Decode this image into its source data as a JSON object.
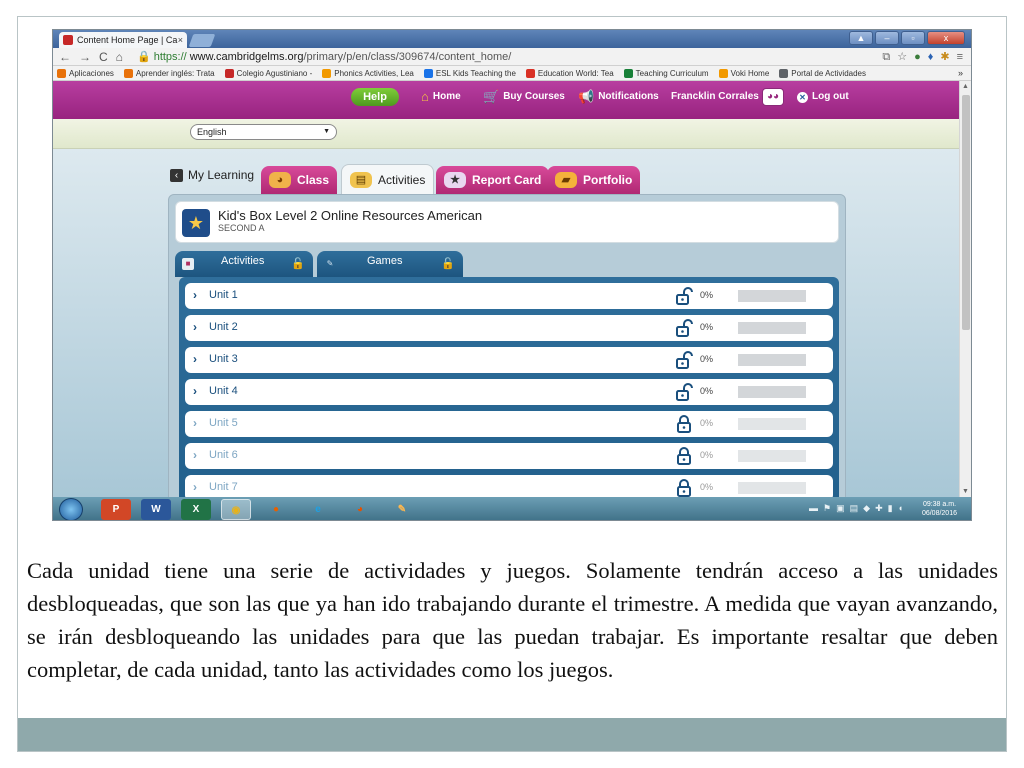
{
  "browser": {
    "tab_title": "Content Home Page | Ca",
    "url_scheme": "https://",
    "url_host": "www.cambridgelms.org",
    "url_path": "/primary/p/en/class/309674/content_home/",
    "bookmarks": [
      {
        "label": "Aplicaciones",
        "color": "#5f6368"
      },
      {
        "label": "Aprender inglés: Trata",
        "color": "#e8710a"
      },
      {
        "label": "Colegio Agustiniano -",
        "color": "#c62828"
      },
      {
        "label": "Phonics Activities, Lea",
        "color": "#f29900"
      },
      {
        "label": "ESL Kids Teaching the",
        "color": "#1a73e8"
      },
      {
        "label": "Education World: Tea",
        "color": "#d93025"
      },
      {
        "label": "Teaching Curriculum",
        "color": "#188038"
      },
      {
        "label": "Voki Home",
        "color": "#f29900"
      },
      {
        "label": "Portal de Actividades",
        "color": "#5f6368"
      }
    ],
    "bookmarks_more": "»"
  },
  "site_nav": {
    "help": "Help",
    "home": "Home",
    "buy_courses": "Buy Courses",
    "notifications": "Notifications",
    "user_name": "Francklin Corrales",
    "logout": "Log out"
  },
  "language": {
    "selected": "English"
  },
  "learning": {
    "my_learning": "My Learning",
    "tabs": [
      {
        "label": "Class"
      },
      {
        "label": "Activities"
      },
      {
        "label": "Report Card"
      },
      {
        "label": "Portfolio"
      }
    ]
  },
  "course": {
    "title": "Kid's Box Level 2 Online Resources American",
    "subtitle": "SECOND A"
  },
  "sub_tabs": [
    {
      "label": "Activities"
    },
    {
      "label": "Games"
    }
  ],
  "units": [
    {
      "label": "Unit 1",
      "progress": "0%",
      "progress_value": 0,
      "unlocked": true
    },
    {
      "label": "Unit 2",
      "progress": "0%",
      "progress_value": 0,
      "unlocked": true
    },
    {
      "label": "Unit 3",
      "progress": "0%",
      "progress_value": 0,
      "unlocked": true
    },
    {
      "label": "Unit 4",
      "progress": "0%",
      "progress_value": 0,
      "unlocked": true
    },
    {
      "label": "Unit 5",
      "progress": "0%",
      "progress_value": 0,
      "unlocked": false
    },
    {
      "label": "Unit 6",
      "progress": "0%",
      "progress_value": 0,
      "unlocked": false
    },
    {
      "label": "Unit 7",
      "progress": "0%",
      "progress_value": 0,
      "unlocked": false
    }
  ],
  "taskbar": {
    "time": "09:38 a.m.",
    "date": "06/08/2016"
  },
  "caption": "Cada unidad tiene una serie de actividades y juegos. Solamente tendrán acceso a las unidades desbloqueadas, que son las que ya han ido trabajando durante el trimestre. A medida que vayan avanzando, se irán desbloqueando las unidades para que las puedan trabajar. Es importante resaltar que deben completar, de cada unidad, tanto las actividades como los juegos.",
  "colors": {
    "site_nav": "#a8308f",
    "help_button": "#5fb02a",
    "tab_pink": "#c5377f",
    "panel_blue": "#22608c",
    "slide_footer": "#8fa9ab"
  }
}
